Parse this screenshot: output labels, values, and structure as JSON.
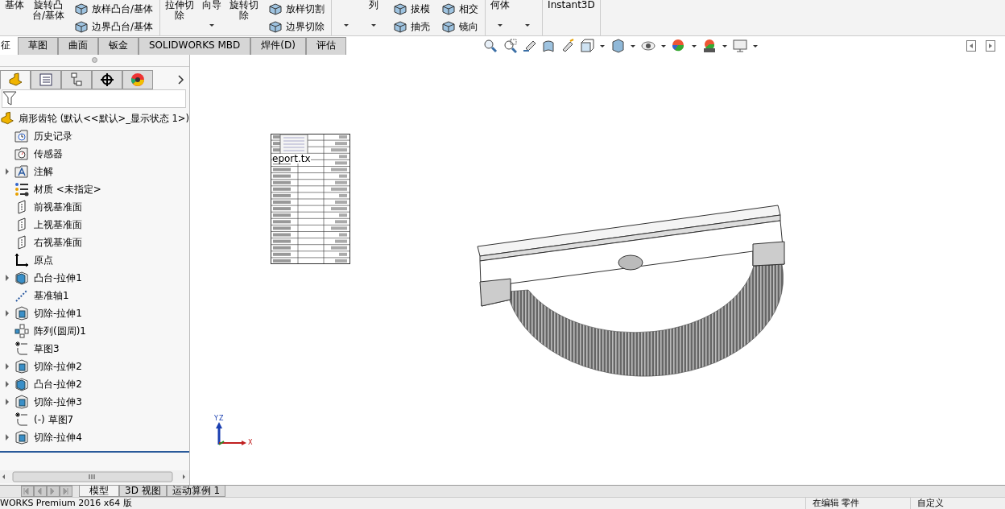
{
  "ribbon_groups": [
    [
      {
        "kind": "large",
        "lines": [
          "基体"
        ],
        "dropdown": false
      },
      {
        "kind": "large",
        "lines": [
          "旋转凸",
          "台/基体"
        ],
        "dropdown": false
      },
      {
        "kind": "stack",
        "buttons": [
          "放样凸台/基体",
          "边界凸台/基体"
        ]
      }
    ],
    [
      {
        "kind": "large",
        "lines": [
          "拉伸切",
          "除"
        ],
        "dropdown": false
      },
      {
        "kind": "large",
        "lines": [
          "向导"
        ],
        "dropdown": true
      },
      {
        "kind": "large",
        "lines": [
          "旋转切",
          "除"
        ],
        "dropdown": false
      },
      {
        "kind": "stack",
        "buttons": [
          "放样切割",
          "边界切除"
        ]
      }
    ],
    [
      {
        "kind": "large",
        "dropdown": true
      },
      {
        "kind": "large",
        "lines": [
          "列"
        ],
        "dropdown": true
      },
      {
        "kind": "stack",
        "buttons": [
          "拔模",
          "抽壳"
        ]
      },
      {
        "kind": "stack",
        "buttons": [
          "相交",
          "镜向"
        ]
      }
    ],
    [
      {
        "kind": "large",
        "lines": [
          "何体"
        ],
        "dropdown": true
      },
      {
        "kind": "large",
        "dropdown": true
      }
    ],
    [
      {
        "kind": "large",
        "lines": [
          "Instant3D"
        ],
        "dropdown": false
      }
    ]
  ],
  "tabs": [
    {
      "label": "征",
      "selected": true
    },
    {
      "label": "草图",
      "selected": false
    },
    {
      "label": "曲面",
      "selected": false
    },
    {
      "label": "钣金",
      "selected": false
    },
    {
      "label": "SOLIDWORKS MBD",
      "selected": false
    },
    {
      "label": "焊件(D)",
      "selected": false
    },
    {
      "label": "评估",
      "selected": false
    }
  ],
  "panel_tabs": [
    {
      "selected": true
    },
    {
      "selected": false
    },
    {
      "selected": false
    },
    {
      "selected": false
    },
    {
      "selected": false
    }
  ],
  "tree": {
    "root": "扇形齿轮  (默认<<默认>_显示状态 1>)",
    "items": [
      {
        "kind": "history",
        "label": "历史记录",
        "expandable": false
      },
      {
        "kind": "sensor",
        "label": "传感器",
        "expandable": false
      },
      {
        "kind": "annotation",
        "label": "注解",
        "expandable": true
      },
      {
        "kind": "material",
        "label": "材质 <未指定>",
        "expandable": false
      },
      {
        "kind": "plane",
        "label": "前视基准面",
        "expandable": false
      },
      {
        "kind": "plane",
        "label": "上视基准面",
        "expandable": false
      },
      {
        "kind": "plane",
        "label": "右视基准面",
        "expandable": false
      },
      {
        "kind": "origin",
        "label": "原点",
        "expandable": false
      },
      {
        "kind": "boss",
        "label": "凸台-拉伸1",
        "expandable": true
      },
      {
        "kind": "axis",
        "label": "基准轴1",
        "expandable": false
      },
      {
        "kind": "cut",
        "label": "切除-拉伸1",
        "expandable": true
      },
      {
        "kind": "pattern",
        "label": "阵列(圆周)1",
        "expandable": false
      },
      {
        "kind": "sketch",
        "label": "草图3",
        "expandable": false
      },
      {
        "kind": "cut",
        "label": "切除-拉伸2",
        "expandable": true
      },
      {
        "kind": "boss",
        "label": "凸台-拉伸2",
        "expandable": true
      },
      {
        "kind": "cut",
        "label": "切除-拉伸3",
        "expandable": true
      },
      {
        "kind": "sketch",
        "label": "(-) 草图7",
        "expandable": false
      },
      {
        "kind": "cut",
        "label": "切除-拉伸4",
        "expandable": true
      }
    ]
  },
  "embedded_table": {
    "caption": "eport.tx"
  },
  "triad": {
    "axes": [
      "Y",
      "Z",
      "X"
    ]
  },
  "bottom_tabs": [
    {
      "label": "模型",
      "selected": true
    },
    {
      "label": "3D 视图",
      "selected": false
    },
    {
      "label": "运动算例 1",
      "selected": false
    }
  ],
  "status_bar": [
    "WORKS Premium 2016 x64 版",
    "在编辑 零件",
    "自定义"
  ]
}
